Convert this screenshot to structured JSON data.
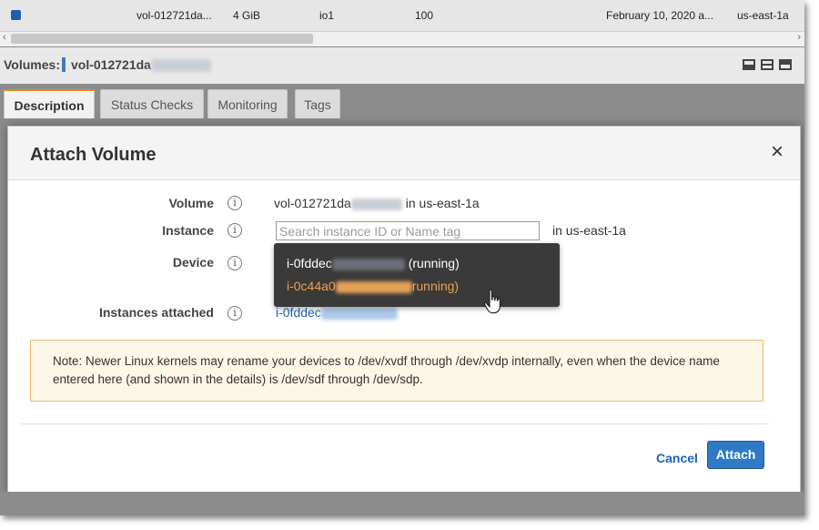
{
  "volume_row": {
    "volume_id": "vol-012721da...",
    "size": "4 GiB",
    "volume_type": "io1",
    "iops": "100",
    "created": "February 10, 2020 a...",
    "availability_zone": "us-east-1a"
  },
  "details_header": {
    "label": "Volumes:",
    "volume_name": "vol-012721da"
  },
  "tabs": [
    {
      "label": "Description"
    },
    {
      "label": "Status Checks"
    },
    {
      "label": "Monitoring"
    },
    {
      "label": "Tags"
    }
  ],
  "modal": {
    "title": "Attach Volume",
    "close_symbol": "×",
    "fields": {
      "volume_label": "Volume",
      "volume_value": "vol-012721da",
      "volume_zone": "in us-east-1a",
      "instance_label": "Instance",
      "instance_placeholder": "Search instance ID or Name tag",
      "instance_zone": "in us-east-1a",
      "device_label": "Device",
      "attached_label": "Instances attached",
      "attached_value": "i-0fddec"
    },
    "dropdown": [
      {
        "id": "i-0fddec",
        "status": "(running)"
      },
      {
        "id": "i-0c44a0",
        "status": "running)"
      }
    ],
    "note": "Note: Newer Linux kernels may rename your devices to /dev/xvdf through /dev/xvdp internally, even when the device name entered here (and shown in the details) is /dev/sdf through /dev/sdp.",
    "cancel_label": "Cancel",
    "attach_label": "Attach"
  },
  "colors": {
    "accent_orange": "#e88b1e",
    "primary_blue": "#2f7ac4",
    "link_blue": "#1a63b8",
    "dropdown_bg": "#3a3a3a",
    "note_bg": "#fdf7e8"
  }
}
